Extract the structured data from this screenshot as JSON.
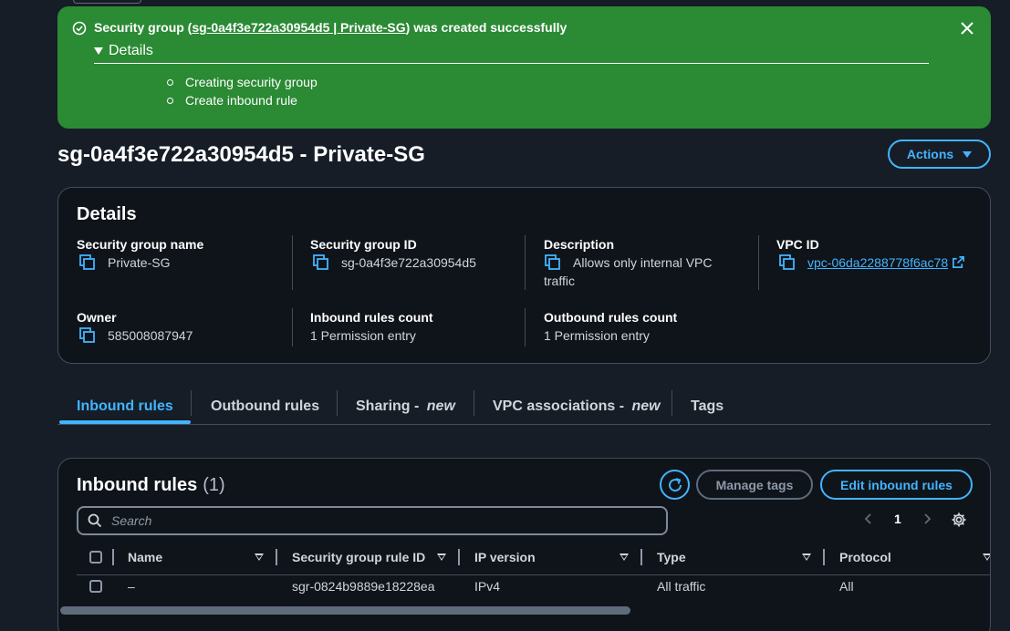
{
  "flash": {
    "prefix": "Security group (",
    "link_text": "sg-0a4f3e722a30954d5 | Private-SG",
    "suffix": ") was created successfully",
    "details_label": "Details",
    "steps": [
      "Creating security group",
      "Create inbound rule"
    ],
    "color": "#2b8a34"
  },
  "page": {
    "title": "sg-0a4f3e722a30954d5 - Private-SG",
    "actions_label": "Actions"
  },
  "details": {
    "heading": "Details",
    "sg_name": {
      "label": "Security group name",
      "value": "Private-SG"
    },
    "sg_id": {
      "label": "Security group ID",
      "value": "sg-0a4f3e722a30954d5"
    },
    "description": {
      "label": "Description",
      "value": "Allows only internal VPC traffic"
    },
    "vpc_id": {
      "label": "VPC ID",
      "value": "vpc-06da2288778f6ac78"
    },
    "owner": {
      "label": "Owner",
      "value": "585008087947"
    },
    "inbound_count": {
      "label": "Inbound rules count",
      "value": "1 Permission entry"
    },
    "outbound_count": {
      "label": "Outbound rules count",
      "value": "1 Permission entry"
    }
  },
  "tabs": [
    {
      "label": "Inbound rules",
      "new": ""
    },
    {
      "label": "Outbound rules",
      "new": ""
    },
    {
      "label": "Sharing - ",
      "new": "new"
    },
    {
      "label": "VPC associations - ",
      "new": "new"
    },
    {
      "label": "Tags",
      "new": ""
    }
  ],
  "inbound": {
    "title": "Inbound rules",
    "count": "(1)",
    "manage_tags": "Manage tags",
    "edit_rules": "Edit inbound rules",
    "search_placeholder": "Search",
    "page_number": "1",
    "columns": [
      "Name",
      "Security group rule ID",
      "IP version",
      "Type",
      "Protocol"
    ],
    "rows": [
      {
        "name": "–",
        "rule_id": "sgr-0824b9889e18228ea",
        "ip_version": "IPv4",
        "type": "All traffic",
        "protocol": "All"
      }
    ]
  },
  "icons": {
    "status": "check-circle-icon",
    "close": "close-icon",
    "copy": "copy-icon",
    "external": "external-link-icon",
    "refresh": "refresh-icon",
    "search": "search-icon",
    "settings": "gear-icon"
  },
  "colors": {
    "accent": "#42b4ff",
    "background": "#161d26",
    "container": "#0f141a",
    "success": "#2b8a34"
  }
}
